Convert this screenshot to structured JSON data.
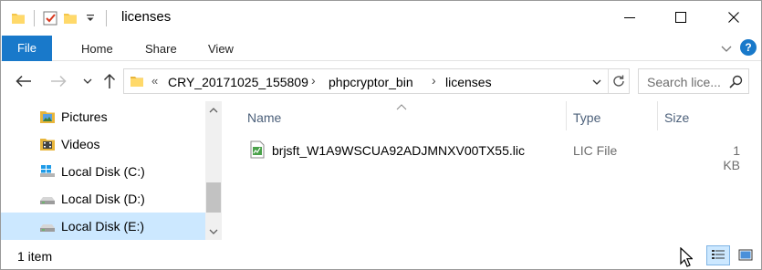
{
  "window": {
    "title": "licenses"
  },
  "quick_access": {
    "icons": [
      "folder-icon",
      "properties-checkmark-icon",
      "new-folder-icon",
      "customize-qat-dropdown-icon"
    ]
  },
  "window_controls": {
    "icons": [
      "minimize-icon",
      "maximize-icon",
      "close-icon"
    ]
  },
  "ribbon": {
    "tabs": [
      {
        "label": "File"
      },
      {
        "label": "Home"
      },
      {
        "label": "Share"
      },
      {
        "label": "View"
      }
    ],
    "help_label": "?",
    "accent_color": "#1979ca"
  },
  "address_bar": {
    "overflow_label": "«",
    "separator": "›",
    "breadcrumbs": [
      {
        "label": "CRY_20171025_155809"
      },
      {
        "label": "phpcryptor_bin"
      },
      {
        "label": "licenses"
      }
    ]
  },
  "search": {
    "placeholder": "Search lice..."
  },
  "nav_pane": {
    "items": [
      {
        "label": "Pictures",
        "icon": "pictures-folder-icon",
        "selected": false
      },
      {
        "label": "Videos",
        "icon": "videos-folder-icon",
        "selected": false
      },
      {
        "label": "Local Disk (C:)",
        "icon": "windows-drive-icon",
        "selected": false
      },
      {
        "label": "Local Disk (D:)",
        "icon": "drive-icon",
        "selected": false
      },
      {
        "label": "Local Disk (E:)",
        "icon": "drive-icon",
        "selected": true
      }
    ],
    "selection_color": "#cce8ff"
  },
  "file_list": {
    "columns": [
      {
        "label": "Name"
      },
      {
        "label": "Type"
      },
      {
        "label": "Size"
      }
    ],
    "rows": [
      {
        "name": "brjsft_W1A9WSCUA92ADJMNXV00TX55.lic",
        "type": "LIC File",
        "size": "1 KB",
        "icon": "lic-file-icon"
      }
    ]
  },
  "status_bar": {
    "item_count": "1 item",
    "view_modes": [
      "details-view-icon",
      "large-icons-view-icon"
    ]
  }
}
